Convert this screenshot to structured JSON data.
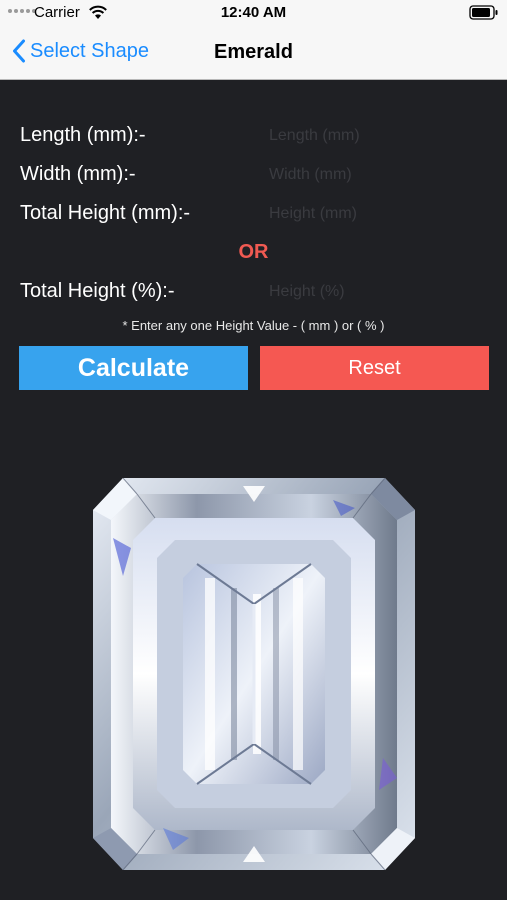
{
  "status_bar": {
    "carrier": "Carrier",
    "time": "12:40 AM"
  },
  "nav": {
    "back_label": "Select Shape",
    "title": "Emerald"
  },
  "form": {
    "length_label": "Length (mm):-",
    "length_placeholder": "Length (mm)",
    "width_label": "Width (mm):-",
    "width_placeholder": "Width (mm)",
    "height_mm_label": "Total Height (mm):-",
    "height_mm_placeholder": "Height (mm)",
    "or_label": "OR",
    "height_pct_label": "Total Height (%):-",
    "height_pct_placeholder": "Height (%)",
    "note": "* Enter any one Height Value - ( mm ) or ( % )"
  },
  "buttons": {
    "calculate_label": "Calculate",
    "reset_label": "Reset"
  },
  "colors": {
    "background": "#1f2024",
    "accent_blue": "#37a3ee",
    "accent_red": "#f55852",
    "or_red": "#f05a52",
    "ios_blue": "#1a8cff"
  }
}
